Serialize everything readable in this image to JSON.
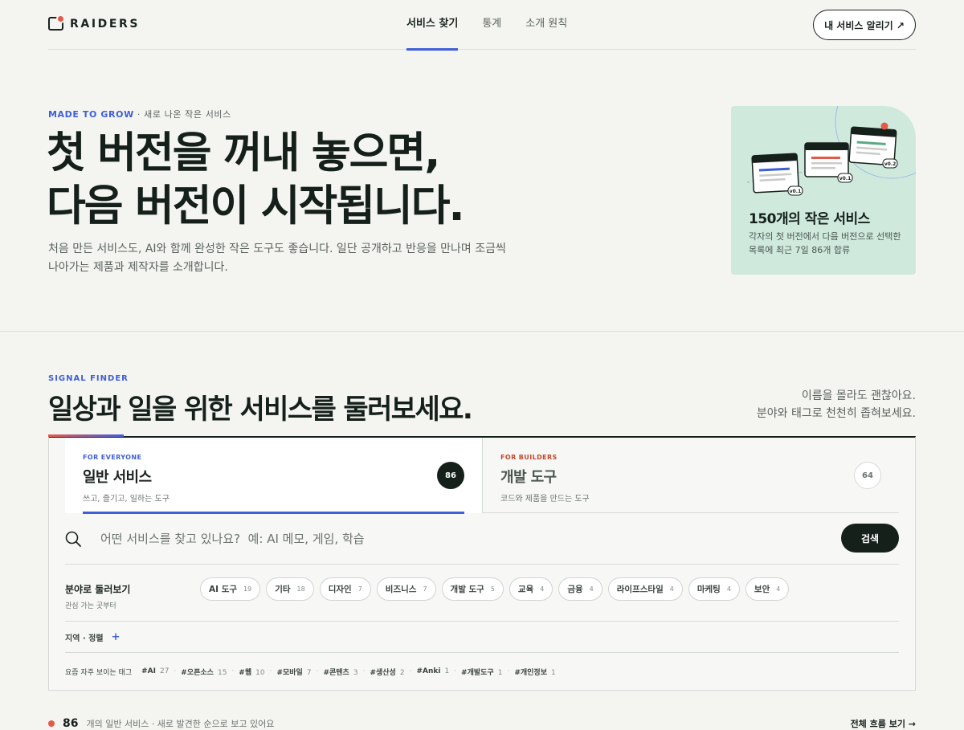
{
  "brand": {
    "name": "RAIDERS"
  },
  "nav": {
    "items": [
      {
        "label": "서비스 찾기",
        "active": true
      },
      {
        "label": "통계",
        "active": false
      },
      {
        "label": "소개 원칙",
        "active": false
      }
    ],
    "cta_label": "내 서비스 알리기 ↗"
  },
  "hero": {
    "eyebrow_accent": "MADE TO GROW",
    "eyebrow_rest": " · 새로 나온 작은 서비스",
    "title_line1": "첫 버전을 꺼내 놓으면,",
    "title_line2": "다음 버전이 시작됩니다.",
    "description": "처음 만든 서비스도, AI와 함께 완성한 작은 도구도 좋습니다. 일단 공개하고 반응을 만나며 조금씩 나아가는 제품과 제작자를 소개합니다.",
    "card": {
      "title": "150개의 작은 서비스",
      "description": "각자의 첫 버전에서 다음 버전으로 선택한 목록에 최근 7일 86개 합류",
      "versions": [
        "v0.1",
        "v0.1",
        "v0.2"
      ]
    }
  },
  "finder": {
    "eyebrow": "SIGNAL FINDER",
    "title": "일상과 일을 위한 서비스를 둘러보세요.",
    "side_line1": "이름을 몰라도 괜찮아요.",
    "side_line2": "분야와 태그로 천천히 좁혀보세요.",
    "tabs": [
      {
        "kicker": "FOR EVERYONE",
        "name": "일반 서비스",
        "sub": "쓰고, 즐기고, 일하는 도구",
        "count": "86",
        "active": true
      },
      {
        "kicker": "FOR BUILDERS",
        "name": "개발 도구",
        "sub": "코드와 제품을 만드는 도구",
        "count": "64",
        "active": false
      }
    ],
    "search": {
      "placeholder": "어떤 서비스를 찾고 있나요?  예: AI 메모, 게임, 학습",
      "button_label": "검색"
    },
    "categories": {
      "label": "분야로 둘러보기",
      "sub": "관심 가는 곳부터",
      "chips": [
        {
          "label": "AI 도구",
          "count": "19"
        },
        {
          "label": "기타",
          "count": "18"
        },
        {
          "label": "디자인",
          "count": "7"
        },
        {
          "label": "비즈니스",
          "count": "7"
        },
        {
          "label": "개발 도구",
          "count": "5"
        },
        {
          "label": "교육",
          "count": "4"
        },
        {
          "label": "금융",
          "count": "4"
        },
        {
          "label": "라이프스타일",
          "count": "4"
        },
        {
          "label": "마케팅",
          "count": "4"
        },
        {
          "label": "보안",
          "count": "4"
        }
      ]
    },
    "region": {
      "label": "지역 · 정렬",
      "plus": "+"
    },
    "tags": {
      "label": "요즘 자주 보이는 태그",
      "items": [
        {
          "label": "#AI",
          "count": "27"
        },
        {
          "label": "#오픈소스",
          "count": "15"
        },
        {
          "label": "#웹",
          "count": "10"
        },
        {
          "label": "#모바일",
          "count": "7"
        },
        {
          "label": "#콘텐츠",
          "count": "3"
        },
        {
          "label": "#생산성",
          "count": "2"
        },
        {
          "label": "#Anki",
          "count": "1"
        },
        {
          "label": "#개발도구",
          "count": "1"
        },
        {
          "label": "#개인정보",
          "count": "1"
        }
      ]
    }
  },
  "bottom": {
    "count": "86",
    "left_text": "개의 일반 서비스 · 새로 발견한 순으로 보고 있어요",
    "right_text": "전체 흐름 보기 →"
  },
  "colors": {
    "accent": "#3f5fd8",
    "ink": "#16201b",
    "coral": "#e45a49",
    "mint": "#cfe9dd",
    "background": "#f4f5f1"
  }
}
